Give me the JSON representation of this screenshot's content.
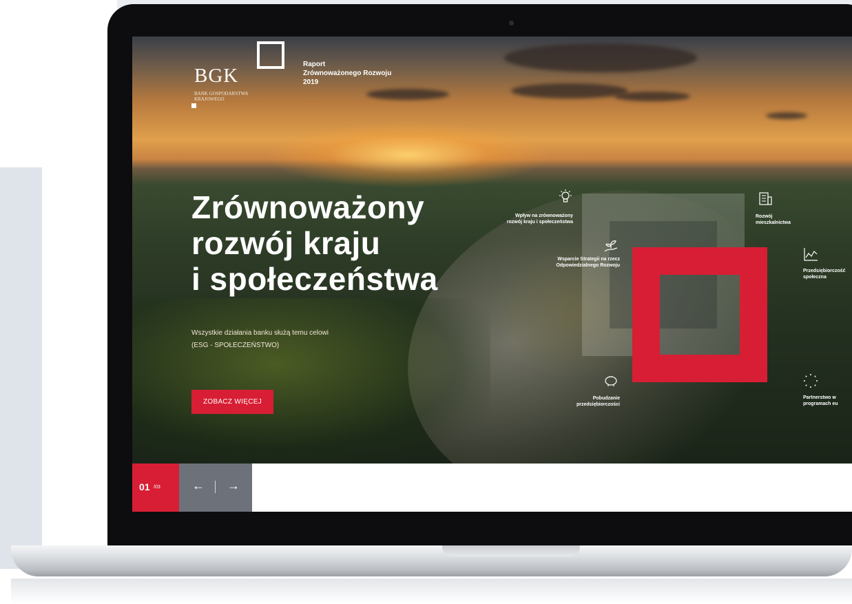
{
  "logo": {
    "wordmark": "BGK",
    "subtitle_line1": "BANK GOSPODARSTWA",
    "subtitle_line2": "KRAJOWEGO"
  },
  "report": {
    "line1": "Raport",
    "line2": "Zrównoważonego Rozwoju",
    "line3": "2019"
  },
  "hero": {
    "headline_line1": "Zrównoważony",
    "headline_line2": "rozwój kraju",
    "headline_line3": "i społeczeństwa",
    "subtitle_line1": "Wszystkie działania banku służą temu celowi",
    "subtitle_line2": "(ESG - SPOŁECZEŃSTWO)",
    "cta_label": "ZOBACZ WIĘCEJ"
  },
  "topics": [
    {
      "label_line1": "Wpływ na zrównoważony",
      "label_line2": "rozwój kraju i społeczeństwa",
      "icon": "lightbulb-icon"
    },
    {
      "label_line1": "Wsparcie Strategii na rzecz",
      "label_line2": "Odpowiedzialnego Rozwoju",
      "icon": "hand-plant-icon"
    },
    {
      "label_line1": "Pobudzanie",
      "label_line2": "przedsiębiorczości",
      "icon": "piggy-bank-icon"
    },
    {
      "label_line1": "Rozwój",
      "label_line2": "mieszkalnictwa",
      "icon": "building-icon"
    },
    {
      "label_line1": "Przedsiębiorczość",
      "label_line2": "społeczna",
      "icon": "chart-icon"
    },
    {
      "label_line1": "Partnerstwo w",
      "label_line2": "programach eu",
      "icon": "stars-circle-icon"
    }
  ],
  "pager": {
    "current": "01",
    "total": "/03",
    "prev": "←",
    "next": "→"
  },
  "colors": {
    "accent": "#d81e34",
    "pager_grey": "#6d7179"
  }
}
